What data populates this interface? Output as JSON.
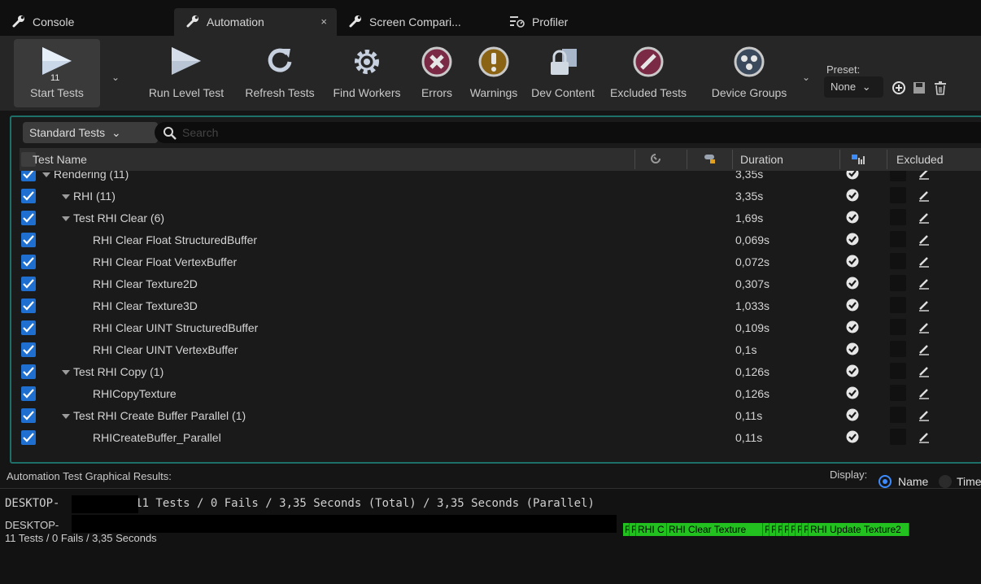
{
  "tabs": [
    {
      "label": "Console",
      "icon": "wrench-icon"
    },
    {
      "label": "Automation",
      "icon": "wrench-icon",
      "close": "×"
    },
    {
      "label": "Screen Compari...",
      "icon": "wrench-icon"
    },
    {
      "label": "Profiler",
      "icon": "profiler-icon"
    }
  ],
  "toolbar": {
    "start_label": "Start Tests",
    "test_count": "11",
    "run_level": "Run Level Test",
    "refresh": "Refresh Tests",
    "find_workers": "Find Workers",
    "errors": "Errors",
    "warnings": "Warnings",
    "dev_content": "Dev Content",
    "excluded_tests": "Excluded Tests",
    "device_groups": "Device Groups",
    "preset_label": "Preset:",
    "preset_value": "None"
  },
  "filter": {
    "label": "Standard Tests",
    "search_placeholder": "Search"
  },
  "columns": {
    "test_name": "Test Name",
    "duration": "Duration",
    "excluded": "Excluded"
  },
  "rows": [
    {
      "name": "Rendering (11)",
      "duration": "3,35s"
    },
    {
      "name": "RHI (11)",
      "duration": "3,35s"
    },
    {
      "name": "Test RHI Clear (6)",
      "duration": "1,69s"
    },
    {
      "name": "RHI Clear Float StructuredBuffer",
      "duration": "0,069s"
    },
    {
      "name": "RHI Clear Float VertexBuffer",
      "duration": "0,072s"
    },
    {
      "name": "RHI Clear Texture2D",
      "duration": "0,307s"
    },
    {
      "name": "RHI Clear Texture3D",
      "duration": "1,033s"
    },
    {
      "name": "RHI Clear UINT StructuredBuffer",
      "duration": "0,109s"
    },
    {
      "name": "RHI Clear UINT VertexBuffer",
      "duration": "0,1s"
    },
    {
      "name": "Test RHI Copy (1)",
      "duration": "0,126s"
    },
    {
      "name": "RHICopyTexture",
      "duration": "0,126s"
    },
    {
      "name": "Test RHI Create Buffer Parallel (1)",
      "duration": "0,11s"
    },
    {
      "name": "RHICreateBuffer_Parallel",
      "duration": "0,11s"
    }
  ],
  "results": {
    "title": "Automation Test Graphical Results:",
    "display_label": "Display:",
    "display_name": "Name",
    "display_time": "Time",
    "summary": "DESKTOP-         - 11 Tests / 0 Fails / 3,35 Seconds (Total) / 3,35 Seconds (Parallel)",
    "device": "DESKTOP-",
    "device_summary": "11 Tests / 0 Fails / 3,35 Seconds",
    "bars": [
      "R",
      "R",
      "RHI C",
      "RHI Clear Texture",
      "R",
      "R",
      "R",
      "R",
      "R",
      "R",
      "R",
      "RHI Update Texture2"
    ]
  },
  "colors": {
    "accent_teal": "#1d6f6a",
    "checkbox_blue": "#1f6fd1",
    "pass_green": "#22c11f"
  }
}
